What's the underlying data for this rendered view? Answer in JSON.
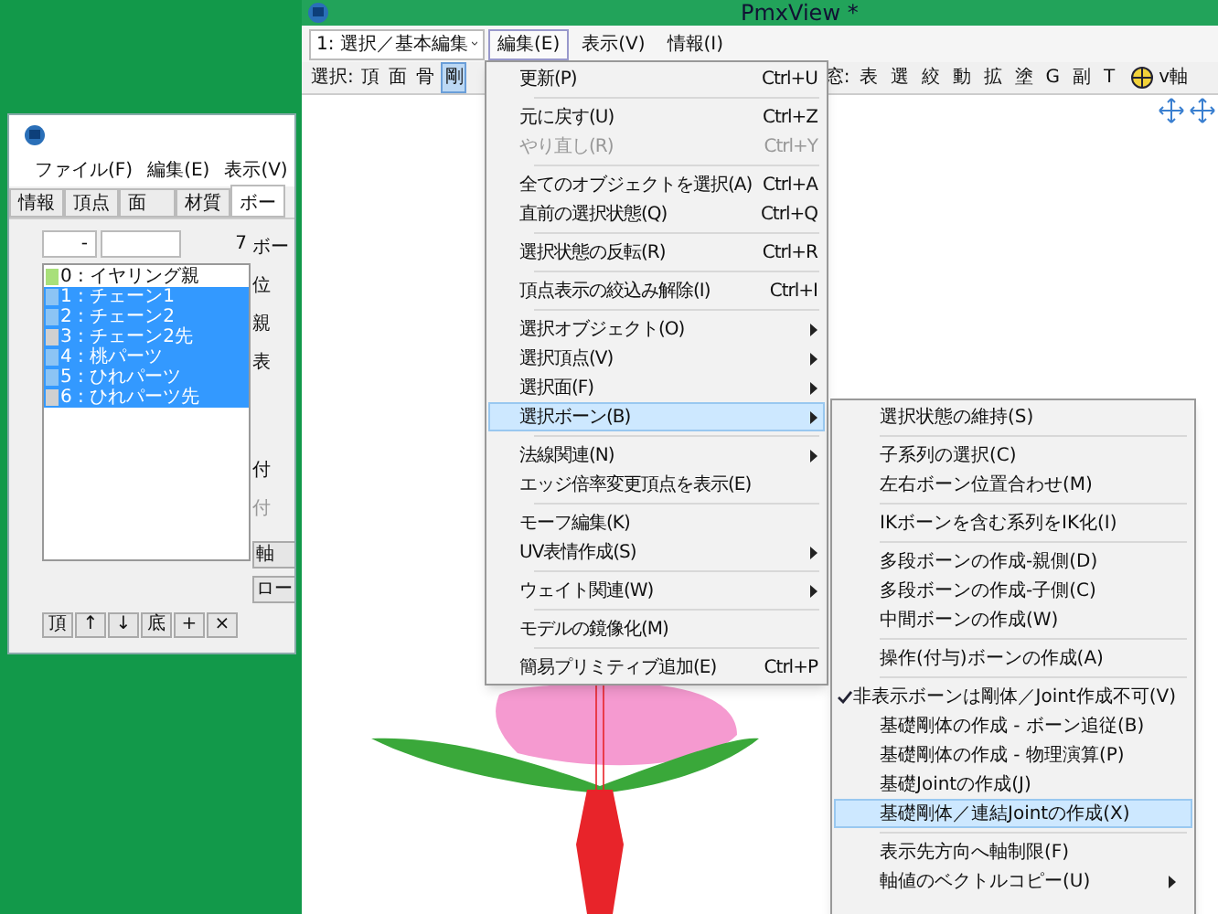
{
  "side_window": {
    "menu": [
      "ファイル(F)",
      "編集(E)",
      "表示(V)"
    ],
    "tabs": [
      {
        "label": "情報",
        "selected": false
      },
      {
        "label": "頂点",
        "selected": false
      },
      {
        "label": "面",
        "selected": false
      },
      {
        "label": "材質",
        "selected": false
      },
      {
        "label": "ボー",
        "selected": true
      }
    ],
    "range_from": "-",
    "count": "7",
    "bones": [
      {
        "label": "0 : イヤリング親",
        "selected": false,
        "color": "#a8e07a"
      },
      {
        "label": "1 : チェーン1",
        "selected": true,
        "color": "#8cc4f4"
      },
      {
        "label": "2 : チェーン2",
        "selected": true,
        "color": "#8cc4f4"
      },
      {
        "label": "3 : チェーン2先",
        "selected": true,
        "color": "#d0d0d0"
      },
      {
        "label": "4 : 桃パーツ",
        "selected": true,
        "color": "#8cc4f4"
      },
      {
        "label": "5 : ひれパーツ",
        "selected": true,
        "color": "#8cc4f4"
      },
      {
        "label": "6 : ひれパーツ先",
        "selected": true,
        "color": "#d0d0d0"
      }
    ],
    "side_labels": [
      "ボー",
      "位",
      "親",
      "表",
      "付",
      "付"
    ],
    "side_buttons": [
      "軸",
      "ロー"
    ],
    "list_buttons": [
      "頂",
      "↑",
      "↓",
      "底",
      "+",
      "×"
    ]
  },
  "main_window": {
    "title": "PmxView *",
    "mode": "1: 選択／基本編集",
    "menu": [
      {
        "label": "編集(E)",
        "selected": true
      },
      {
        "label": "表示(V)",
        "selected": false
      },
      {
        "label": "情報(I)",
        "selected": false
      }
    ],
    "toolbar_label": "選択:",
    "select_buttons": [
      {
        "label": "頂",
        "selected": false
      },
      {
        "label": "面",
        "selected": false
      },
      {
        "label": "骨",
        "selected": false
      },
      {
        "label": "剛",
        "selected": true
      }
    ],
    "window_label": "窓:",
    "window_buttons": [
      "表",
      "選",
      "絞",
      "動",
      "拡",
      "塗",
      "G",
      "副",
      "T"
    ],
    "axis_label": "v軸"
  },
  "edit_menu": [
    {
      "kind": "item",
      "label": "更新(P)",
      "shortcut": "Ctrl+U",
      "submenu": false,
      "disabled": false,
      "selected": false
    },
    {
      "kind": "separator"
    },
    {
      "kind": "item",
      "label": "元に戻す(U)",
      "shortcut": "Ctrl+Z",
      "submenu": false,
      "disabled": false,
      "selected": false
    },
    {
      "kind": "item",
      "label": "やり直し(R)",
      "shortcut": "Ctrl+Y",
      "submenu": false,
      "disabled": true,
      "selected": false
    },
    {
      "kind": "separator"
    },
    {
      "kind": "item",
      "label": "全てのオブジェクトを選択(A)",
      "shortcut": "Ctrl+A",
      "submenu": false,
      "disabled": false,
      "selected": false
    },
    {
      "kind": "item",
      "label": "直前の選択状態(Q)",
      "shortcut": "Ctrl+Q",
      "submenu": false,
      "disabled": false,
      "selected": false
    },
    {
      "kind": "separator"
    },
    {
      "kind": "item",
      "label": "選択状態の反転(R)",
      "shortcut": "Ctrl+R",
      "submenu": false,
      "disabled": false,
      "selected": false
    },
    {
      "kind": "separator"
    },
    {
      "kind": "item",
      "label": "頂点表示の絞込み解除(I)",
      "shortcut": "Ctrl+I",
      "submenu": false,
      "disabled": false,
      "selected": false
    },
    {
      "kind": "separator"
    },
    {
      "kind": "item",
      "label": "選択オブジェクト(O)",
      "submenu": true,
      "disabled": false,
      "selected": false
    },
    {
      "kind": "item",
      "label": "選択頂点(V)",
      "submenu": true,
      "disabled": false,
      "selected": false
    },
    {
      "kind": "item",
      "label": "選択面(F)",
      "submenu": true,
      "disabled": false,
      "selected": false
    },
    {
      "kind": "item",
      "label": "選択ボーン(B)",
      "submenu": true,
      "disabled": false,
      "selected": true
    },
    {
      "kind": "separator"
    },
    {
      "kind": "item",
      "label": "法線関連(N)",
      "submenu": true,
      "disabled": false,
      "selected": false
    },
    {
      "kind": "item",
      "label": "エッジ倍率変更頂点を表示(E)",
      "submenu": false,
      "disabled": false,
      "selected": false
    },
    {
      "kind": "separator"
    },
    {
      "kind": "item",
      "label": "モーフ編集(K)",
      "submenu": false,
      "disabled": false,
      "selected": false
    },
    {
      "kind": "item",
      "label": "UV表情作成(S)",
      "submenu": true,
      "disabled": false,
      "selected": false
    },
    {
      "kind": "separator"
    },
    {
      "kind": "item",
      "label": "ウェイト関連(W)",
      "submenu": true,
      "disabled": false,
      "selected": false
    },
    {
      "kind": "separator"
    },
    {
      "kind": "item",
      "label": "モデルの鏡像化(M)",
      "submenu": false,
      "disabled": false,
      "selected": false
    },
    {
      "kind": "separator"
    },
    {
      "kind": "item",
      "label": "簡易プリミティブ追加(E)",
      "shortcut": "Ctrl+P",
      "submenu": false,
      "disabled": false,
      "selected": false
    }
  ],
  "bone_menu": [
    {
      "kind": "item",
      "label": "選択状態の維持(S)",
      "checked": false,
      "submenu": false,
      "selected": false
    },
    {
      "kind": "separator"
    },
    {
      "kind": "item",
      "label": "子系列の選択(C)",
      "checked": false,
      "submenu": false,
      "selected": false
    },
    {
      "kind": "item",
      "label": "左右ボーン位置合わせ(M)",
      "checked": false,
      "submenu": false,
      "selected": false
    },
    {
      "kind": "separator"
    },
    {
      "kind": "item",
      "label": "IKボーンを含む系列をIK化(I)",
      "checked": false,
      "submenu": false,
      "selected": false
    },
    {
      "kind": "separator"
    },
    {
      "kind": "item",
      "label": "多段ボーンの作成-親側(D)",
      "checked": false,
      "submenu": false,
      "selected": false
    },
    {
      "kind": "item",
      "label": "多段ボーンの作成-子側(C)",
      "checked": false,
      "submenu": false,
      "selected": false
    },
    {
      "kind": "item",
      "label": "中間ボーンの作成(W)",
      "checked": false,
      "submenu": false,
      "selected": false
    },
    {
      "kind": "separator"
    },
    {
      "kind": "item",
      "label": "操作(付与)ボーンの作成(A)",
      "checked": false,
      "submenu": false,
      "selected": false
    },
    {
      "kind": "separator"
    },
    {
      "kind": "item",
      "label": "非表示ボーンは剛体／Joint作成不可(V)",
      "checked": true,
      "submenu": false,
      "selected": false
    },
    {
      "kind": "item",
      "label": "基礎剛体の作成 - ボーン追従(B)",
      "checked": false,
      "submenu": false,
      "selected": false
    },
    {
      "kind": "item",
      "label": "基礎剛体の作成 - 物理演算(P)",
      "checked": false,
      "submenu": false,
      "selected": false
    },
    {
      "kind": "item",
      "label": "基礎Jointの作成(J)",
      "checked": false,
      "submenu": false,
      "selected": false
    },
    {
      "kind": "item",
      "label": "基礎剛体／連結Jointの作成(X)",
      "checked": false,
      "submenu": false,
      "selected": true
    },
    {
      "kind": "separator"
    },
    {
      "kind": "item",
      "label": "表示先方向へ軸制限(F)",
      "checked": false,
      "submenu": false,
      "selected": false
    },
    {
      "kind": "item",
      "label": "軸値のベクトルコピー(U)",
      "checked": false,
      "submenu": true,
      "selected": false
    }
  ]
}
